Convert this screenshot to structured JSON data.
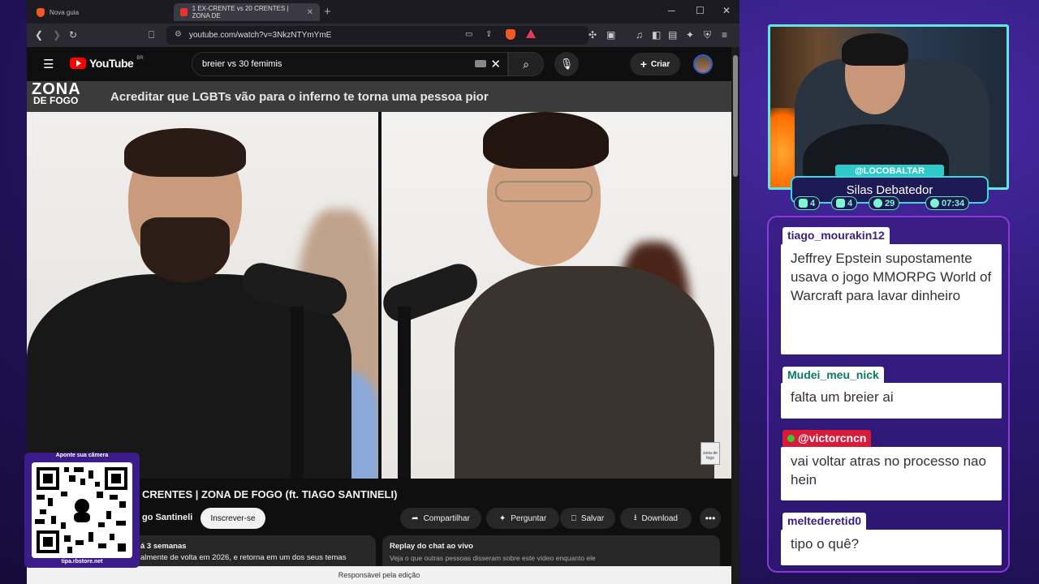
{
  "browser": {
    "tabs": [
      {
        "label": "Nova guia"
      },
      {
        "label": "1 EX-CRENTE vs 20 CRENTES | ZONA DE"
      }
    ],
    "url": "youtube.com/watch?v=3NkzNTYmYmE"
  },
  "youtube": {
    "logo_text": "YouTube",
    "country": "BR",
    "search_value": "breier vs 30 femimis",
    "create_label": "Criar",
    "banner_logo_top": "ZONA",
    "banner_logo_bottom": "DE FOGO",
    "banner_text": "Acreditar que LGBTs vão para o inferno te torna uma pessoa pior",
    "watermark": "zona de fogo",
    "video_title": "CRENTES | ZONA DE FOGO (ft. TIAGO SANTINELI)",
    "channel_name": "go Santineli",
    "subscribe_label": "Inscrever-se",
    "actions": [
      "Compartilhar",
      "Perguntar",
      "Salvar",
      "Download"
    ],
    "description_line1": "á 3 semanas",
    "description_line2": "almente de volta em 2026, e retorna em um dos seus temas",
    "replay_title": "Replay do chat ao vivo",
    "replay_sub": "Veja o que outras pessoas disseram sobre este vídeo enquanto ele",
    "footer": "Responsável pela edição"
  },
  "overlay": {
    "qr_caption": "Aponte sua câmera",
    "qr_url": "tipa.rbstore.net",
    "handle": "@LOCOBALTAR",
    "streamer_name": "Silas Debatedor",
    "stats": [
      {
        "icon": "twitch-icon",
        "value": "4"
      },
      {
        "icon": "youtube-icon",
        "value": "4"
      },
      {
        "icon": "kick-icon",
        "value": "29"
      },
      {
        "icon": "clock-icon",
        "value": "07:34"
      }
    ]
  },
  "chat": [
    {
      "user": "tiago_mourakin12",
      "message": "Jeffrey Epstein supostamente usava o jogo MMORPG World of Warcraft para lavar dinheiro"
    },
    {
      "user": "Mudei_meu_nick",
      "message": "falta um breier ai"
    },
    {
      "user": "@victorcncn",
      "message": "vai voltar atras no processo nao hein"
    },
    {
      "user": "meltederetid0",
      "message": "tipo o quê?"
    }
  ]
}
